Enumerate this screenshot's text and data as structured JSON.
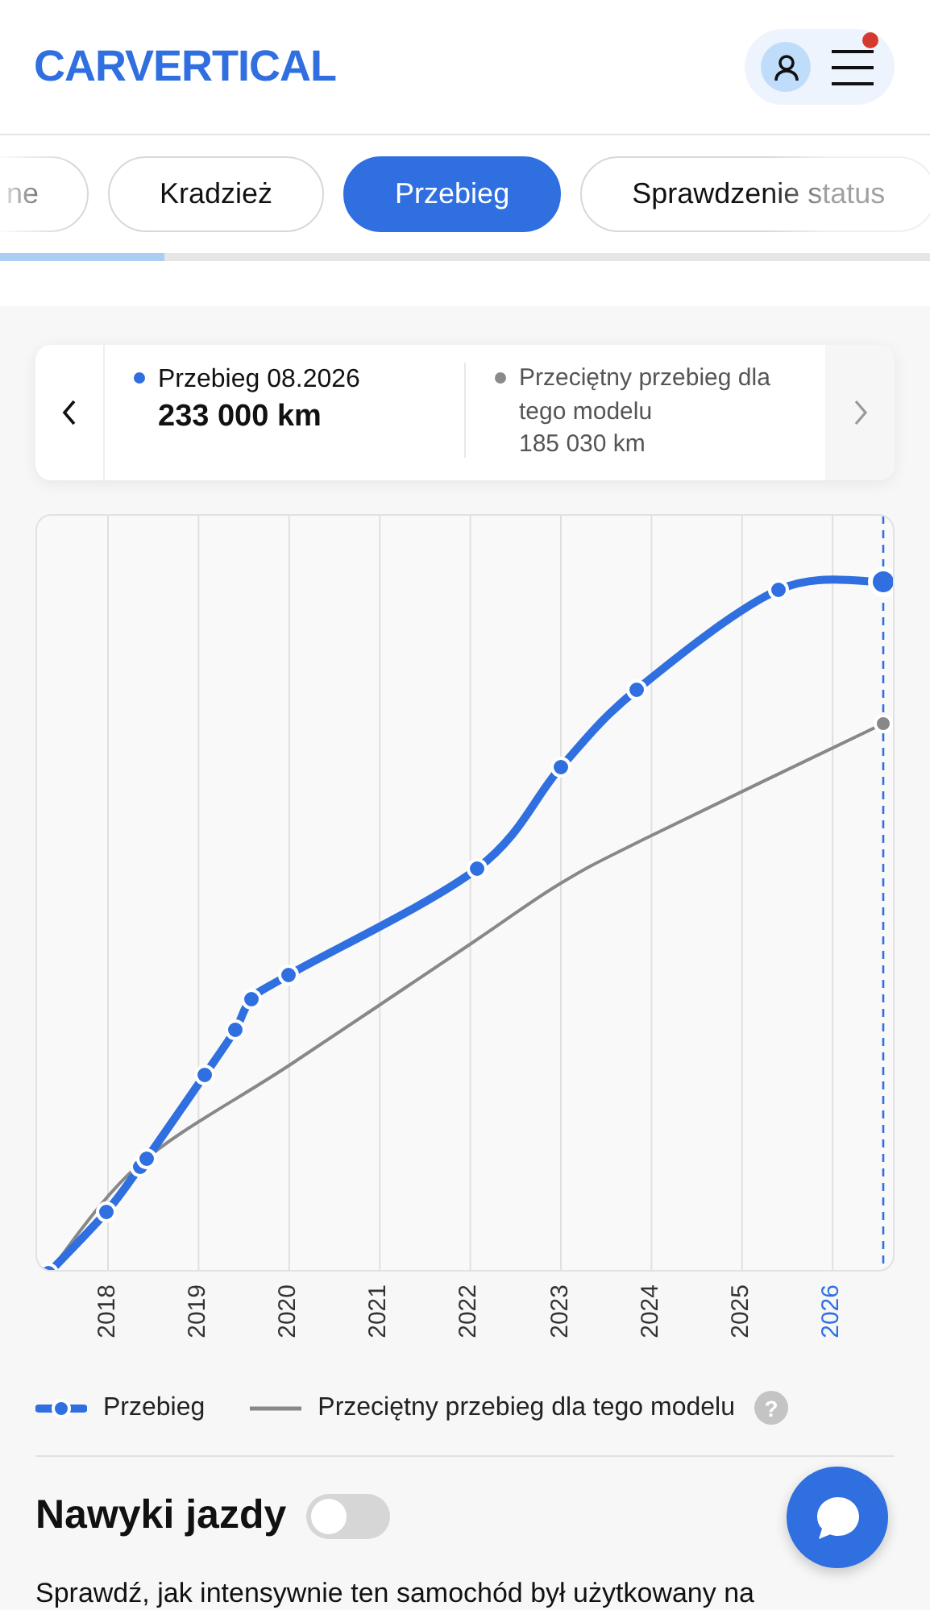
{
  "header": {
    "logo": "CARVERTICAL",
    "notification": true
  },
  "tabs": [
    {
      "label": "ne",
      "selected": false
    },
    {
      "label": "Kradzież",
      "selected": false
    },
    {
      "label": "Przebieg",
      "selected": true
    },
    {
      "label": "Sprawdzenie status",
      "selected": false
    }
  ],
  "summary_card": {
    "items": [
      {
        "label": "Przebieg 08.2026",
        "value": "233 000 km",
        "color": "#2f6fe0"
      },
      {
        "label": "Przeciętny przebieg dla tego modelu",
        "value": "185 030 km",
        "color": "#8a8a8a"
      }
    ]
  },
  "chart": {
    "x_labels": [
      {
        "label": "2018",
        "selected": false
      },
      {
        "label": "2019",
        "selected": false
      },
      {
        "label": "2020",
        "selected": false
      },
      {
        "label": "2021",
        "selected": false
      },
      {
        "label": "2022",
        "selected": false
      },
      {
        "label": "2023",
        "selected": false
      },
      {
        "label": "2024",
        "selected": false
      },
      {
        "label": "2025",
        "selected": false
      },
      {
        "label": "2026",
        "selected": true
      }
    ],
    "legend": [
      {
        "label": "Przebieg",
        "kind": "marker-line"
      },
      {
        "label": "Przeciętny przebieg dla tego modelu",
        "kind": "line"
      }
    ],
    "help": "?"
  },
  "habits": {
    "title": "Nawyki jazdy",
    "on": false,
    "description": "Sprawdź, jak intensywnie ten samochód był użytkowany na"
  }
}
